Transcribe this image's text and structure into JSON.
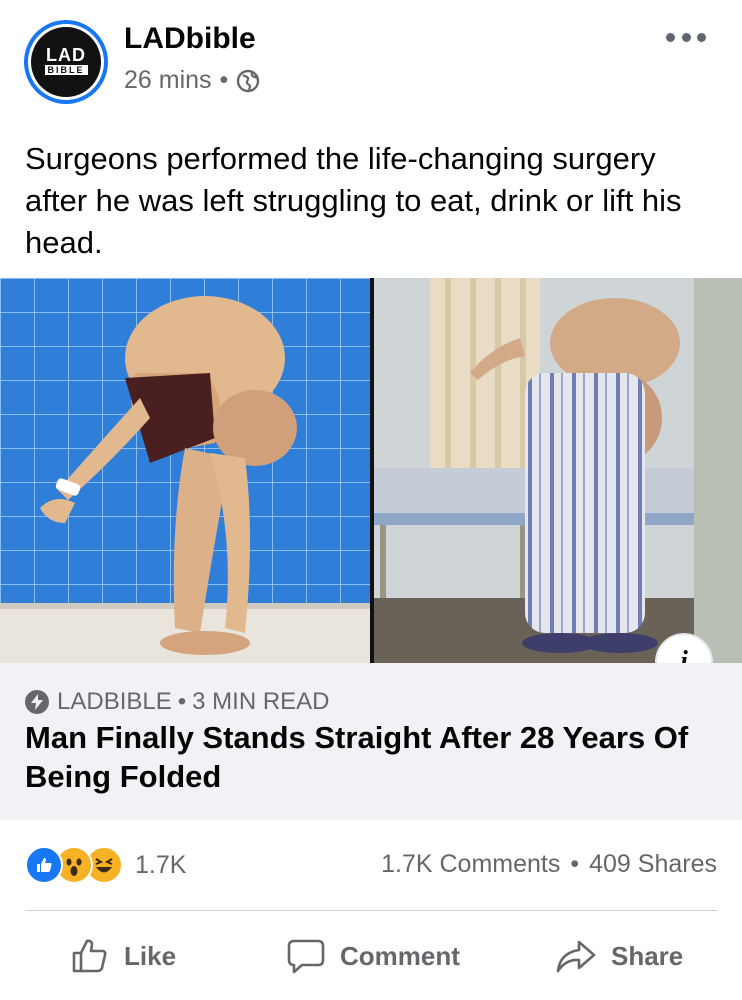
{
  "post": {
    "page_name": "LADbible",
    "time": "26 mins",
    "separator": "•",
    "privacy_icon": "globe-icon",
    "more_icon": "more-dots-icon",
    "avatar_logo_top": "LAD",
    "avatar_logo_bottom": "BIBLE",
    "caption": "Surgeons performed the life-changing surgery after he was left struggling to eat, drink or lift his head."
  },
  "link": {
    "source_icon": "bolt-icon",
    "source": "LADBIBLE",
    "separator": "•",
    "read_time": "3 MIN READ",
    "headline": "Man Finally Stands Straight After 28 Years Of Being Folded",
    "info_label": "i"
  },
  "engagement": {
    "reaction_icons": [
      "like-reaction-icon",
      "wow-reaction-icon",
      "haha-reaction-icon"
    ],
    "reaction_count": "1.7K",
    "comments": "1.7K Comments",
    "separator": "•",
    "shares": "409 Shares"
  },
  "actions": {
    "like": "Like",
    "comment": "Comment",
    "share": "Share"
  },
  "colors": {
    "brand_blue": "#1877f2",
    "secondary_text": "#65676b",
    "link_box_bg": "#f0f2f5",
    "wall_blue": "#2f7fd8"
  }
}
